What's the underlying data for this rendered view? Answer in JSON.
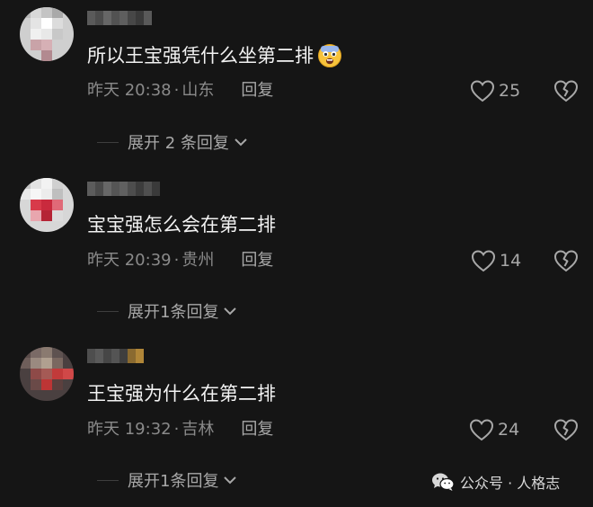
{
  "comments": [
    {
      "text": "所以王宝强凭什么坐第二排",
      "emoji": "scared-face-emoji",
      "time": "昨天 20:38",
      "sep": "·",
      "location": "山东",
      "reply": "回复",
      "likes": "25",
      "expand": "展开 2 条回复"
    },
    {
      "text": "宝宝强怎么会在第二排",
      "emoji": "",
      "time": "昨天 20:39",
      "sep": "·",
      "location": "贵州",
      "reply": "回复",
      "likes": "14",
      "expand": "展开1条回复"
    },
    {
      "text": "王宝强为什么在第二排",
      "emoji": "",
      "time": "昨天 19:32",
      "sep": "·",
      "location": "吉林",
      "reply": "回复",
      "likes": "24",
      "expand": "展开1条回复"
    }
  ],
  "watermark": {
    "text": "公众号 · 人格志",
    "icon": "wechat-icon"
  },
  "colors": {
    "background": "#151515",
    "text": "#f2f2f2",
    "meta": "#8a8a8a",
    "icon": "#a8a8a8"
  }
}
